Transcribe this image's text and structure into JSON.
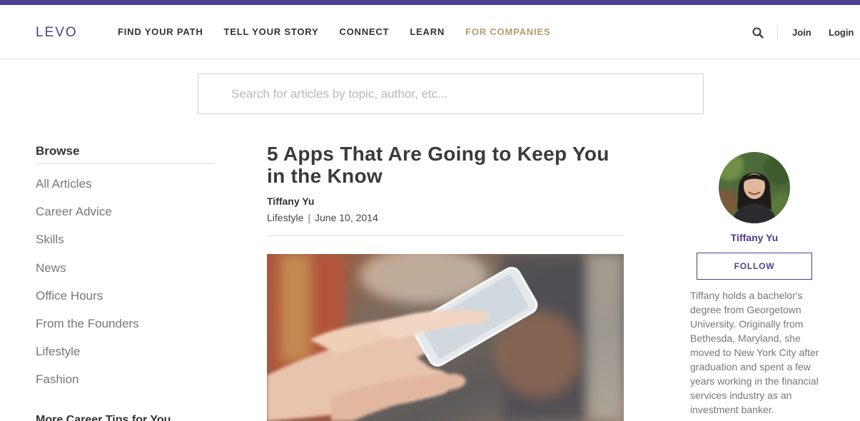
{
  "header": {
    "logo": "LEVO",
    "nav": [
      {
        "label": "FIND YOUR PATH",
        "accent": false
      },
      {
        "label": "TELL YOUR STORY",
        "accent": false
      },
      {
        "label": "CONNECT",
        "accent": false
      },
      {
        "label": "LEARN",
        "accent": false
      },
      {
        "label": "FOR COMPANIES",
        "accent": true
      }
    ],
    "search_icon": "search-icon",
    "join_label": "Join",
    "login_label": "Login"
  },
  "search": {
    "placeholder": "Search for articles by topic, author, etc..."
  },
  "sidebar": {
    "title": "Browse",
    "items": [
      {
        "label": "All Articles"
      },
      {
        "label": "Career Advice"
      },
      {
        "label": "Skills"
      },
      {
        "label": "News"
      },
      {
        "label": "Office Hours"
      },
      {
        "label": "From the Founders"
      },
      {
        "label": "Lifestyle"
      },
      {
        "label": "Fashion"
      }
    ],
    "more_title": "More Career Tips for You"
  },
  "article": {
    "title": "5 Apps That Are Going to Keep You in the Know",
    "author": "Tiffany Yu",
    "category": "Lifestyle",
    "separator": "|",
    "date": "June 10, 2014"
  },
  "author_card": {
    "name": "Tiffany Yu",
    "follow_label": "FOLLOW",
    "bio": "Tiffany holds a bachelor's degree from Georgetown University. Originally from Bethesda, Maryland, she moved to New York City after graduation and spent a few years working in the financial services industry as an investment banker."
  },
  "colors": {
    "brand": "#4f3d8f",
    "accent_gold": "#b49e6f",
    "muted_text": "#777777"
  }
}
